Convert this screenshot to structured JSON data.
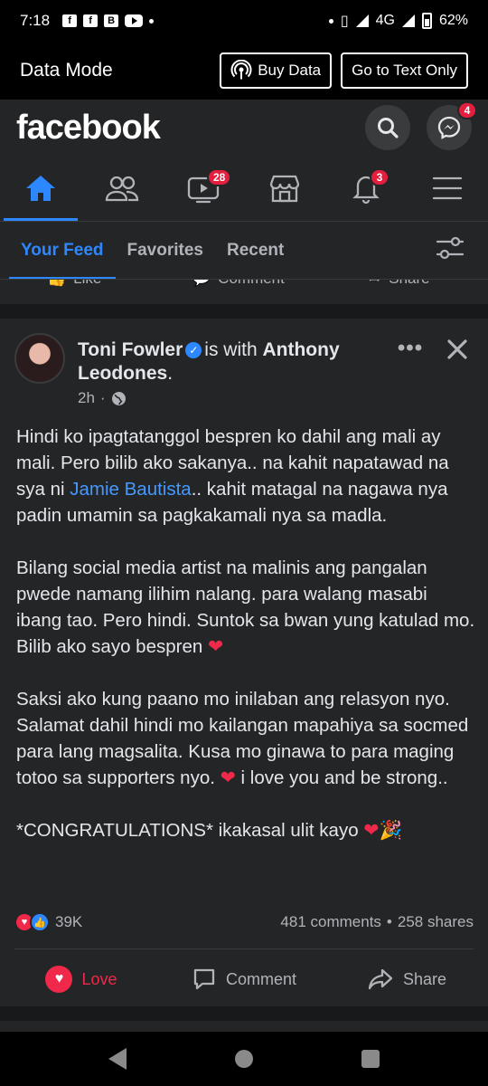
{
  "status_bar": {
    "time": "7:18",
    "icons": [
      "f",
      "f",
      "B"
    ],
    "network": "4G",
    "battery": "62%"
  },
  "data_bar": {
    "label": "Data Mode",
    "buy_data": "Buy Data",
    "text_only": "Go to Text Only"
  },
  "header": {
    "logo": "facebook",
    "messenger_badge": "4"
  },
  "nav": {
    "watch_badge": "28",
    "notifications_badge": "3"
  },
  "feed_tabs": [
    "Your Feed",
    "Favorites",
    "Recent"
  ],
  "prev_post_actions": [
    "Like",
    "Comment",
    "Share"
  ],
  "post": {
    "author": "Toni Fowler",
    "with_text": "is with",
    "tagged": "Anthony Leodones",
    "time": "2h",
    "paragraph1_a": "Hindi ko ipagtatanggol bespren ko dahil ang mali ay mali. Pero bilib ako sakanya.. na kahit napatawad na sya ni ",
    "paragraph1_link": "Jamie Bautista",
    "paragraph1_b": ".. kahit matagal na nagawa nya padin umamin sa pagkakamali nya sa madla.",
    "paragraph2": "Bilang social media artist na malinis ang pangalan pwede namang ilihim nalang. para walang masabi ibang tao. Pero hindi. Suntok sa bwan yung katulad mo. Bilib ako sayo bespren",
    "paragraph3_a": "Saksi ako kung paano mo inilaban ang relasyon nyo. Salamat dahil hindi mo kailangan mapahiya sa socmed para lang magsalita. Kusa mo ginawa to para maging totoo sa supporters nyo.",
    "paragraph3_b": "i love you and be strong..",
    "paragraph4": "*CONGRATULATIONS* ikakasal ulit kayo",
    "reaction_count": "39K",
    "comments": "481 comments",
    "shares": "258 shares",
    "actions": {
      "love": "Love",
      "comment": "Comment",
      "share": "Share"
    }
  },
  "colors": {
    "accent": "#2d88ff",
    "love": "#f02849",
    "surface": "#242526",
    "background": "#18191a"
  }
}
